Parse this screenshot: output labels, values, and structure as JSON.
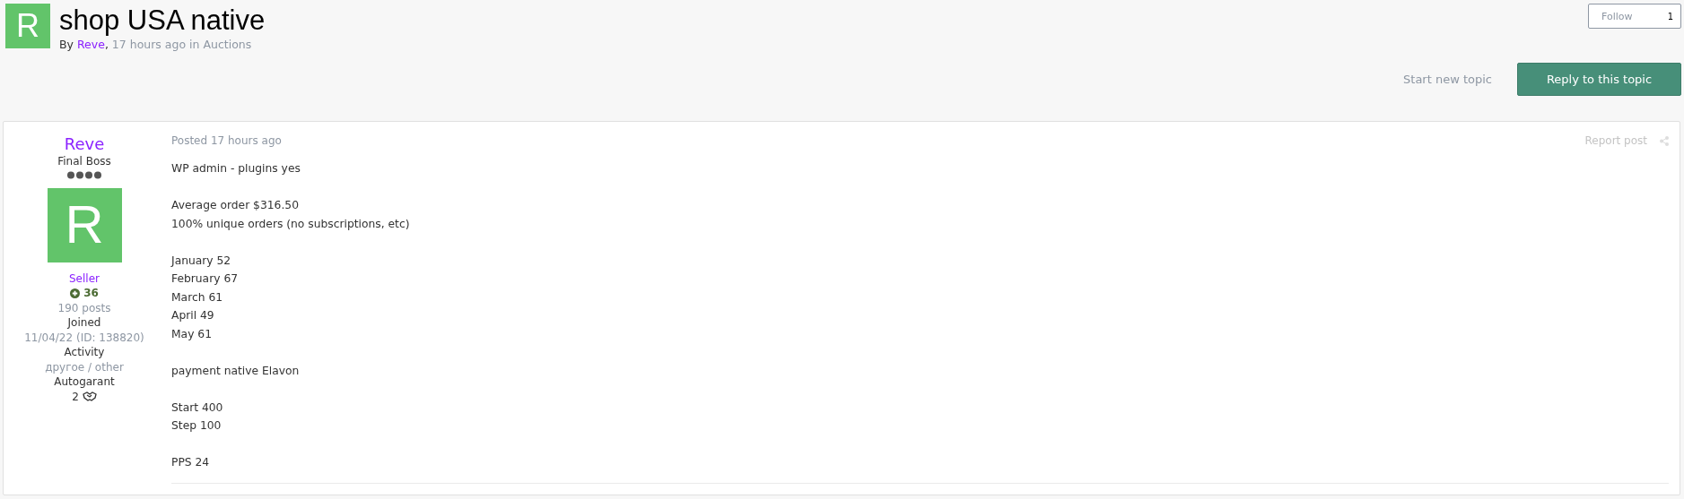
{
  "topic": {
    "avatar_letter": "R",
    "title": "shop USA native",
    "by": "By",
    "author": "Reve",
    "separator": ",",
    "time": "17 hours ago",
    "in": "in",
    "forum": "Auctions"
  },
  "follow": {
    "label": "Follow",
    "count": "1"
  },
  "actions": {
    "start": "Start new topic",
    "reply": "Reply to this topic"
  },
  "post": {
    "author": {
      "name": "Reve",
      "rank": "Final Boss",
      "avatar_letter": "R",
      "group": "Seller",
      "reputation": "36",
      "posts": "190 posts",
      "joined_label": "Joined",
      "joined": "11/04/22 (ID: 138820)",
      "activity_label": "Activity",
      "activity": "другое / other",
      "autogarant_label": "Autogarant",
      "autogarant": "2"
    },
    "posted": "Posted 17 hours ago",
    "report": "Report post",
    "paragraphs": [
      [
        "WP admin - plugins yes"
      ],
      [
        "Average order $316.50",
        "100% unique orders (no subscriptions, etc)"
      ],
      [
        "January 52",
        "February 67",
        "March 61",
        "April 49",
        "May 61"
      ],
      [
        "payment native Elavon"
      ],
      [
        "Start 400",
        "Step 100"
      ],
      [
        "PPS 24"
      ]
    ]
  }
}
